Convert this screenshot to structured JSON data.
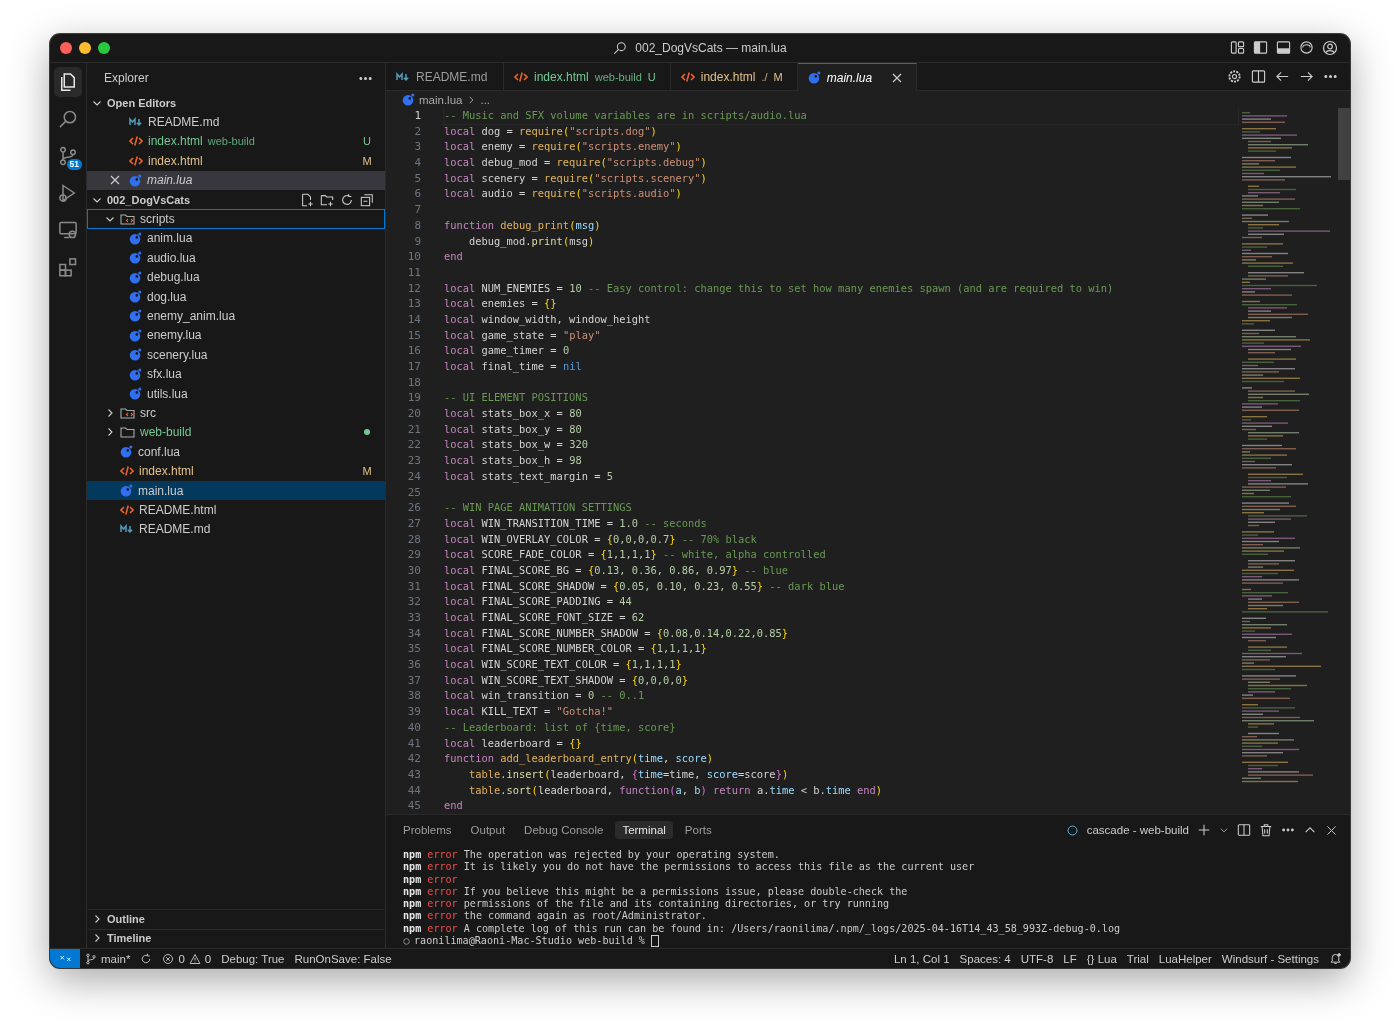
{
  "window": {
    "title": "002_DogVsCats — main.lua"
  },
  "activity_bar": {
    "items": [
      {
        "kind": "explorer",
        "selected": true
      },
      {
        "kind": "search",
        "selected": false
      },
      {
        "kind": "source-control",
        "selected": false,
        "badge": "51"
      },
      {
        "kind": "run",
        "selected": false
      },
      {
        "kind": "remote",
        "selected": false
      },
      {
        "kind": "extensions",
        "selected": false
      }
    ]
  },
  "sidebar": {
    "title": "Explorer",
    "open_editors": {
      "title": "Open Editors",
      "expanded": true,
      "items": [
        {
          "kind": "md",
          "name": "README.md",
          "selected": false,
          "preview": false
        },
        {
          "kind": "html",
          "name": "index.html",
          "detail": "web-build",
          "status": "U",
          "color": "#73c991",
          "selected": false,
          "preview": false
        },
        {
          "kind": "html",
          "name": "index.html",
          "status": "M",
          "color": "#e2c08d",
          "selected": false,
          "preview": false
        },
        {
          "kind": "lua",
          "name": "main.lua",
          "selected": true,
          "preview": true
        }
      ]
    },
    "folder": {
      "name": "002_DogVsCats",
      "expanded": true,
      "children": [
        {
          "kind": "folder-code",
          "name": "scripts",
          "expanded": true,
          "selected": false,
          "focused": true,
          "children": [
            {
              "kind": "lua",
              "name": "anim.lua",
              "selected": false,
              "focused": false
            },
            {
              "kind": "lua",
              "name": "audio.lua",
              "selected": false,
              "focused": false
            },
            {
              "kind": "lua",
              "name": "debug.lua",
              "selected": false,
              "focused": false
            },
            {
              "kind": "lua",
              "name": "dog.lua",
              "selected": false,
              "focused": false
            },
            {
              "kind": "lua",
              "name": "enemy_anim.lua",
              "selected": false,
              "focused": false
            },
            {
              "kind": "lua",
              "name": "enemy.lua",
              "selected": false,
              "focused": false
            },
            {
              "kind": "lua",
              "name": "scenery.lua",
              "selected": false,
              "focused": false
            },
            {
              "kind": "lua",
              "name": "sfx.lua",
              "selected": false,
              "focused": false
            },
            {
              "kind": "lua",
              "name": "utils.lua",
              "selected": false,
              "focused": false
            }
          ]
        },
        {
          "kind": "folder-code",
          "name": "src",
          "expanded": false,
          "selected": false,
          "focused": false
        },
        {
          "kind": "folder",
          "name": "web-build",
          "expanded": false,
          "color": "#73c991",
          "selected": false,
          "focused": false
        },
        {
          "kind": "lua",
          "name": "conf.lua",
          "selected": false,
          "focused": false
        },
        {
          "kind": "html",
          "name": "index.html",
          "status": "M",
          "color": "#e2c08d",
          "selected": false,
          "focused": false
        },
        {
          "kind": "lua",
          "name": "main.lua",
          "selected": true,
          "focused": false
        },
        {
          "kind": "html",
          "name": "README.html",
          "selected": false,
          "focused": false
        },
        {
          "kind": "md",
          "name": "README.md",
          "selected": false,
          "focused": false
        }
      ]
    },
    "sections": [
      {
        "label": "Outline",
        "expanded": false
      },
      {
        "label": "Timeline",
        "expanded": false
      }
    ]
  },
  "tabs": [
    {
      "kind": "md",
      "label": "README.md",
      "selected": false,
      "preview": false
    },
    {
      "kind": "html",
      "label": "index.html",
      "detail": "web-build",
      "status": "U",
      "color": "#73c991",
      "selected": false,
      "preview": false
    },
    {
      "kind": "html",
      "label": "index.html",
      "detail": "./",
      "status": "M",
      "color": "#e2c08d",
      "selected": false,
      "preview": false
    },
    {
      "kind": "lua",
      "label": "main.lua",
      "selected": true,
      "preview": true
    }
  ],
  "breadcrumb": [
    "main.lua",
    "..."
  ],
  "editor": {
    "lines": [
      {
        "number": "1",
        "current": true,
        "tokens": [
          {
            "kind": "comment",
            "text": "-- Music and SFX volume variables are in scripts/audio.lua"
          }
        ]
      },
      {
        "number": "2",
        "current": false,
        "tokens": [
          {
            "kind": "keyword",
            "text": "local"
          },
          {
            "kind": "plain",
            "text": " dog = "
          },
          {
            "kind": "func",
            "text": "require"
          },
          {
            "kind": "bracket",
            "text": "("
          },
          {
            "kind": "string",
            "text": "\"scripts.dog\""
          },
          {
            "kind": "bracket",
            "text": ")"
          }
        ]
      },
      {
        "number": "3",
        "current": false,
        "tokens": [
          {
            "kind": "keyword",
            "text": "local"
          },
          {
            "kind": "plain",
            "text": " enemy = "
          },
          {
            "kind": "func",
            "text": "require"
          },
          {
            "kind": "bracket",
            "text": "("
          },
          {
            "kind": "string",
            "text": "\"scripts.enemy\""
          },
          {
            "kind": "bracket",
            "text": ")"
          }
        ]
      },
      {
        "number": "4",
        "current": false,
        "tokens": [
          {
            "kind": "keyword",
            "text": "local"
          },
          {
            "kind": "plain",
            "text": " debug_mod = "
          },
          {
            "kind": "func",
            "text": "require"
          },
          {
            "kind": "bracket",
            "text": "("
          },
          {
            "kind": "string",
            "text": "\"scripts.debug\""
          },
          {
            "kind": "bracket",
            "text": ")"
          }
        ]
      },
      {
        "number": "5",
        "current": false,
        "tokens": [
          {
            "kind": "keyword",
            "text": "local"
          },
          {
            "kind": "plain",
            "text": " scenery = "
          },
          {
            "kind": "func",
            "text": "require"
          },
          {
            "kind": "bracket",
            "text": "("
          },
          {
            "kind": "string",
            "text": "\"scripts.scenery\""
          },
          {
            "kind": "bracket",
            "text": ")"
          }
        ]
      },
      {
        "number": "6",
        "current": false,
        "tokens": [
          {
            "kind": "keyword",
            "text": "local"
          },
          {
            "kind": "plain",
            "text": " audio = "
          },
          {
            "kind": "func",
            "text": "require"
          },
          {
            "kind": "bracket",
            "text": "("
          },
          {
            "kind": "string",
            "text": "\"scripts.audio\""
          },
          {
            "kind": "bracket",
            "text": ")"
          }
        ]
      },
      {
        "number": "7",
        "current": false
      },
      {
        "number": "8",
        "current": false,
        "tokens": [
          {
            "kind": "keyword",
            "text": "function"
          },
          {
            "kind": "func",
            "text": " debug_print"
          },
          {
            "kind": "bracket",
            "text": "("
          },
          {
            "kind": "param",
            "text": "msg"
          },
          {
            "kind": "bracket",
            "text": ")"
          }
        ]
      },
      {
        "number": "9",
        "current": false,
        "tokens": [
          {
            "kind": "plain",
            "text": "    debug_mod."
          },
          {
            "kind": "method",
            "text": "print"
          },
          {
            "kind": "bracket",
            "text": "("
          },
          {
            "kind": "plain",
            "text": "msg"
          },
          {
            "kind": "bracket",
            "text": ")"
          }
        ]
      },
      {
        "number": "10",
        "current": false,
        "tokens": [
          {
            "kind": "keyword",
            "text": "end"
          }
        ]
      },
      {
        "number": "11",
        "current": false
      },
      {
        "number": "12",
        "current": false,
        "tokens": [
          {
            "kind": "keyword",
            "text": "local"
          },
          {
            "kind": "plain",
            "text": " NUM_ENEMIES = "
          },
          {
            "kind": "number",
            "text": "10"
          },
          {
            "kind": "comment",
            "text": " -- Easy control: change this to set how many enemies spawn (and are required to win)"
          }
        ]
      },
      {
        "number": "13",
        "current": false,
        "tokens": [
          {
            "kind": "keyword",
            "text": "local"
          },
          {
            "kind": "plain",
            "text": " enemies = "
          },
          {
            "kind": "bracket",
            "text": "{}"
          }
        ]
      },
      {
        "number": "14",
        "current": false,
        "tokens": [
          {
            "kind": "keyword",
            "text": "local"
          },
          {
            "kind": "plain",
            "text": " window_width, window_height"
          }
        ]
      },
      {
        "number": "15",
        "current": false,
        "tokens": [
          {
            "kind": "keyword",
            "text": "local"
          },
          {
            "kind": "plain",
            "text": " game_state = "
          },
          {
            "kind": "string",
            "text": "\"play\""
          }
        ]
      },
      {
        "number": "16",
        "current": false,
        "tokens": [
          {
            "kind": "keyword",
            "text": "local"
          },
          {
            "kind": "plain",
            "text": " game_timer = "
          },
          {
            "kind": "number",
            "text": "0"
          }
        ]
      },
      {
        "number": "17",
        "current": false,
        "tokens": [
          {
            "kind": "keyword",
            "text": "local"
          },
          {
            "kind": "plain",
            "text": " final_time = "
          },
          {
            "kind": "constant",
            "text": "nil"
          }
        ]
      },
      {
        "number": "18",
        "current": false
      },
      {
        "number": "19",
        "current": false,
        "tokens": [
          {
            "kind": "comment",
            "text": "-- UI ELEMENT POSITIONS"
          }
        ]
      },
      {
        "number": "20",
        "current": false,
        "tokens": [
          {
            "kind": "keyword",
            "text": "local"
          },
          {
            "kind": "plain",
            "text": " stats_box_x = "
          },
          {
            "kind": "number",
            "text": "80"
          }
        ]
      },
      {
        "number": "21",
        "current": false,
        "tokens": [
          {
            "kind": "keyword",
            "text": "local"
          },
          {
            "kind": "plain",
            "text": " stats_box_y = "
          },
          {
            "kind": "number",
            "text": "80"
          }
        ]
      },
      {
        "number": "22",
        "current": false,
        "tokens": [
          {
            "kind": "keyword",
            "text": "local"
          },
          {
            "kind": "plain",
            "text": " stats_box_w = "
          },
          {
            "kind": "number",
            "text": "320"
          }
        ]
      },
      {
        "number": "23",
        "current": false,
        "tokens": [
          {
            "kind": "keyword",
            "text": "local"
          },
          {
            "kind": "plain",
            "text": " stats_box_h = "
          },
          {
            "kind": "number",
            "text": "98"
          }
        ]
      },
      {
        "number": "24",
        "current": false,
        "tokens": [
          {
            "kind": "keyword",
            "text": "local"
          },
          {
            "kind": "plain",
            "text": " stats_text_margin = "
          },
          {
            "kind": "number",
            "text": "5"
          }
        ]
      },
      {
        "number": "25",
        "current": false
      },
      {
        "number": "26",
        "current": false,
        "tokens": [
          {
            "kind": "comment",
            "text": "-- WIN PAGE ANIMATION SETTINGS"
          }
        ]
      },
      {
        "number": "27",
        "current": false,
        "tokens": [
          {
            "kind": "keyword",
            "text": "local"
          },
          {
            "kind": "plain",
            "text": " WIN_TRANSITION_TIME = "
          },
          {
            "kind": "number",
            "text": "1.0"
          },
          {
            "kind": "comment",
            "text": " -- seconds"
          }
        ]
      },
      {
        "number": "28",
        "current": false,
        "tokens": [
          {
            "kind": "keyword",
            "text": "local"
          },
          {
            "kind": "plain",
            "text": " WIN_OVERLAY_COLOR = "
          },
          {
            "kind": "bracket",
            "text": "{"
          },
          {
            "kind": "number",
            "text": "0,0,0,0.7"
          },
          {
            "kind": "bracket",
            "text": "}"
          },
          {
            "kind": "comment",
            "text": " -- 70% black"
          }
        ]
      },
      {
        "number": "29",
        "current": false,
        "tokens": [
          {
            "kind": "keyword",
            "text": "local"
          },
          {
            "kind": "plain",
            "text": " SCORE_FADE_COLOR = "
          },
          {
            "kind": "bracket",
            "text": "{"
          },
          {
            "kind": "number",
            "text": "1,1,1,1"
          },
          {
            "kind": "bracket",
            "text": "}"
          },
          {
            "kind": "comment",
            "text": " -- white, alpha controlled"
          }
        ]
      },
      {
        "number": "30",
        "current": false,
        "tokens": [
          {
            "kind": "keyword",
            "text": "local"
          },
          {
            "kind": "plain",
            "text": " FINAL_SCORE_BG = "
          },
          {
            "kind": "bracket",
            "text": "{"
          },
          {
            "kind": "number",
            "text": "0.13, 0.36, 0.86, 0.97"
          },
          {
            "kind": "bracket",
            "text": "}"
          },
          {
            "kind": "comment",
            "text": " -- blue"
          }
        ]
      },
      {
        "number": "31",
        "current": false,
        "tokens": [
          {
            "kind": "keyword",
            "text": "local"
          },
          {
            "kind": "plain",
            "text": " FINAL_SCORE_SHADOW = "
          },
          {
            "kind": "bracket",
            "text": "{"
          },
          {
            "kind": "number",
            "text": "0.05, 0.10, 0.23, 0.55"
          },
          {
            "kind": "bracket",
            "text": "}"
          },
          {
            "kind": "comment",
            "text": " -- dark blue"
          }
        ]
      },
      {
        "number": "32",
        "current": false,
        "tokens": [
          {
            "kind": "keyword",
            "text": "local"
          },
          {
            "kind": "plain",
            "text": " FINAL_SCORE_PADDING = "
          },
          {
            "kind": "number",
            "text": "44"
          }
        ]
      },
      {
        "number": "33",
        "current": false,
        "tokens": [
          {
            "kind": "keyword",
            "text": "local"
          },
          {
            "kind": "plain",
            "text": " FINAL_SCORE_FONT_SIZE = "
          },
          {
            "kind": "number",
            "text": "62"
          }
        ]
      },
      {
        "number": "34",
        "current": false,
        "tokens": [
          {
            "kind": "keyword",
            "text": "local"
          },
          {
            "kind": "plain",
            "text": " FINAL_SCORE_NUMBER_SHADOW = "
          },
          {
            "kind": "bracket",
            "text": "{"
          },
          {
            "kind": "number",
            "text": "0.08,0.14,0.22,0.85"
          },
          {
            "kind": "bracket",
            "text": "}"
          }
        ]
      },
      {
        "number": "35",
        "current": false,
        "tokens": [
          {
            "kind": "keyword",
            "text": "local"
          },
          {
            "kind": "plain",
            "text": " FINAL_SCORE_NUMBER_COLOR = "
          },
          {
            "kind": "bracket",
            "text": "{"
          },
          {
            "kind": "number",
            "text": "1,1,1,1"
          },
          {
            "kind": "bracket",
            "text": "}"
          }
        ]
      },
      {
        "number": "36",
        "current": false,
        "tokens": [
          {
            "kind": "keyword",
            "text": "local"
          },
          {
            "kind": "plain",
            "text": " WIN_SCORE_TEXT_COLOR = "
          },
          {
            "kind": "bracket",
            "text": "{"
          },
          {
            "kind": "number",
            "text": "1,1,1,1"
          },
          {
            "kind": "bracket",
            "text": "}"
          }
        ]
      },
      {
        "number": "37",
        "current": false,
        "tokens": [
          {
            "kind": "keyword",
            "text": "local"
          },
          {
            "kind": "plain",
            "text": " WIN_SCORE_TEXT_SHADOW = "
          },
          {
            "kind": "bracket",
            "text": "{"
          },
          {
            "kind": "number",
            "text": "0,0,0,0"
          },
          {
            "kind": "bracket",
            "text": "}"
          }
        ]
      },
      {
        "number": "38",
        "current": false,
        "tokens": [
          {
            "kind": "keyword",
            "text": "local"
          },
          {
            "kind": "plain",
            "text": " win_transition = "
          },
          {
            "kind": "number",
            "text": "0"
          },
          {
            "kind": "comment",
            "text": " -- 0..1"
          }
        ]
      },
      {
        "number": "39",
        "current": false,
        "tokens": [
          {
            "kind": "keyword",
            "text": "local"
          },
          {
            "kind": "plain",
            "text": " KILL_TEXT = "
          },
          {
            "kind": "string",
            "text": "\"Gotcha!\""
          }
        ]
      },
      {
        "number": "40",
        "current": false,
        "tokens": [
          {
            "kind": "comment",
            "text": "-- Leaderboard: list of {time, score}"
          }
        ]
      },
      {
        "number": "41",
        "current": false,
        "tokens": [
          {
            "kind": "keyword",
            "text": "local"
          },
          {
            "kind": "plain",
            "text": " leaderboard = "
          },
          {
            "kind": "bracket",
            "text": "{}"
          }
        ]
      },
      {
        "number": "42",
        "current": false,
        "tokens": [
          {
            "kind": "keyword",
            "text": "function"
          },
          {
            "kind": "func",
            "text": " add_leaderboard_entry"
          },
          {
            "kind": "bracket",
            "text": "("
          },
          {
            "kind": "param",
            "text": "time"
          },
          {
            "kind": "plain",
            "text": ", "
          },
          {
            "kind": "param",
            "text": "score"
          },
          {
            "kind": "bracket",
            "text": ")"
          }
        ]
      },
      {
        "number": "43",
        "current": false,
        "tokens": [
          {
            "kind": "func",
            "text": "    table"
          },
          {
            "kind": "plain",
            "text": "."
          },
          {
            "kind": "method",
            "text": "insert"
          },
          {
            "kind": "bracket",
            "text": "("
          },
          {
            "kind": "plain",
            "text": "leaderboard, "
          },
          {
            "kind": "bracket2",
            "text": "{"
          },
          {
            "kind": "param",
            "text": "time"
          },
          {
            "kind": "plain",
            "text": "=time, "
          },
          {
            "kind": "param",
            "text": "score"
          },
          {
            "kind": "plain",
            "text": "=score"
          },
          {
            "kind": "bracket2",
            "text": "}"
          },
          {
            "kind": "bracket",
            "text": ")"
          }
        ]
      },
      {
        "number": "44",
        "current": false,
        "tokens": [
          {
            "kind": "func",
            "text": "    table"
          },
          {
            "kind": "plain",
            "text": "."
          },
          {
            "kind": "method",
            "text": "sort"
          },
          {
            "kind": "bracket",
            "text": "("
          },
          {
            "kind": "plain",
            "text": "leaderboard, "
          },
          {
            "kind": "keyword",
            "text": "function"
          },
          {
            "kind": "bracket2",
            "text": "("
          },
          {
            "kind": "param",
            "text": "a"
          },
          {
            "kind": "plain",
            "text": ", "
          },
          {
            "kind": "param",
            "text": "b"
          },
          {
            "kind": "bracket2",
            "text": ")"
          },
          {
            "kind": "keyword",
            "text": " return"
          },
          {
            "kind": "plain",
            "text": " a."
          },
          {
            "kind": "param",
            "text": "time"
          },
          {
            "kind": "plain",
            "text": " < b."
          },
          {
            "kind": "param",
            "text": "time"
          },
          {
            "kind": "keyword",
            "text": " end"
          },
          {
            "kind": "bracket",
            "text": ")"
          }
        ]
      },
      {
        "number": "45",
        "current": false,
        "tokens": [
          {
            "kind": "keyword",
            "text": "end"
          }
        ]
      }
    ]
  },
  "panel": {
    "tabs": [
      {
        "label": "Problems",
        "selected": false
      },
      {
        "label": "Output",
        "selected": false
      },
      {
        "label": "Debug Console",
        "selected": false
      },
      {
        "label": "Terminal",
        "selected": true
      },
      {
        "label": "Ports",
        "selected": false
      }
    ],
    "terminal_title": "cascade - web-build",
    "terminal": [
      {
        "kind": "error",
        "tool": "npm",
        "tag": "error",
        "text": "The operation was rejected by your operating system."
      },
      {
        "kind": "error",
        "tool": "npm",
        "tag": "error",
        "text": "It is likely you do not have the permissions to access this file as the current user"
      },
      {
        "kind": "error",
        "tool": "npm",
        "tag": "error"
      },
      {
        "kind": "error",
        "tool": "npm",
        "tag": "error",
        "text": "If you believe this might be a permissions issue, please double-check the"
      },
      {
        "kind": "error",
        "tool": "npm",
        "tag": "error",
        "text": "permissions of the file and its containing directories, or try running"
      },
      {
        "kind": "error",
        "tool": "npm",
        "tag": "error",
        "text": "the command again as root/Administrator."
      },
      {
        "kind": "error",
        "tool": "npm",
        "tag": "error",
        "text": "A complete log of this run can be found in: /Users/raonilima/.npm/_logs/2025-04-16T14_43_58_993Z-debug-0.log"
      },
      {
        "kind": "prompt",
        "text": "raonilima@Raoni-Mac-Studio web-build %"
      }
    ]
  },
  "status_bar": {
    "left": [
      {
        "kind": "remote"
      },
      {
        "kind": "branch",
        "text": "main*"
      },
      {
        "kind": "sync"
      },
      {
        "kind": "problems",
        "errors": "0",
        "warnings": "0"
      },
      {
        "kind": "text",
        "text": "Debug: True"
      },
      {
        "kind": "text",
        "text": "RunOnSave: False"
      }
    ],
    "right": [
      {
        "kind": "text",
        "text": "Ln 1, Col 1"
      },
      {
        "kind": "text",
        "text": "Spaces: 4"
      },
      {
        "kind": "text",
        "text": "UTF-8"
      },
      {
        "kind": "text",
        "text": "LF"
      },
      {
        "kind": "language",
        "glyph": "{}",
        "text": "Lua"
      },
      {
        "kind": "text",
        "text": "Trial"
      },
      {
        "kind": "text",
        "text": "LuaHelper"
      },
      {
        "kind": "text",
        "text": "Windsurf - Settings"
      },
      {
        "kind": "bell"
      }
    ]
  }
}
